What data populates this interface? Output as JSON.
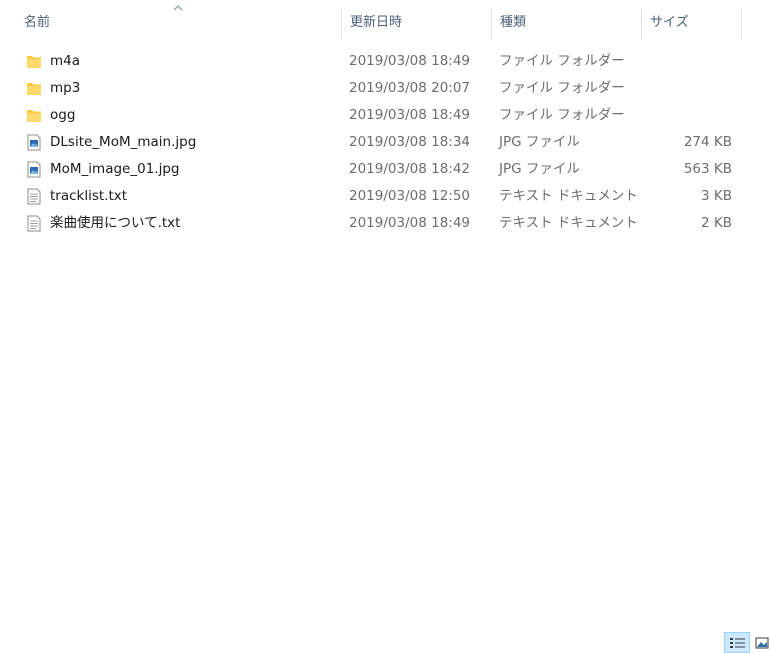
{
  "columns": {
    "name": "名前",
    "date": "更新日時",
    "type": "種類",
    "size": "サイズ"
  },
  "files": [
    {
      "name": "m4a",
      "date": "2019/03/08 18:49",
      "type": "ファイル フォルダー",
      "size": "",
      "icon": "folder-icon"
    },
    {
      "name": "mp3",
      "date": "2019/03/08 20:07",
      "type": "ファイル フォルダー",
      "size": "",
      "icon": "folder-icon"
    },
    {
      "name": "ogg",
      "date": "2019/03/08 18:49",
      "type": "ファイル フォルダー",
      "size": "",
      "icon": "folder-icon"
    },
    {
      "name": "DLsite_MoM_main.jpg",
      "date": "2019/03/08 18:34",
      "type": "JPG ファイル",
      "size": "274 KB",
      "icon": "image-file-icon"
    },
    {
      "name": "MoM_image_01.jpg",
      "date": "2019/03/08 18:42",
      "type": "JPG ファイル",
      "size": "563 KB",
      "icon": "image-file-icon"
    },
    {
      "name": "tracklist.txt",
      "date": "2019/03/08 12:50",
      "type": "テキスト ドキュメント",
      "size": "3 KB",
      "icon": "text-file-icon"
    },
    {
      "name": "楽曲使用について.txt",
      "date": "2019/03/08 18:49",
      "type": "テキスト ドキュメント",
      "size": "2 KB",
      "icon": "text-file-icon"
    }
  ],
  "colors": {
    "header_text": "#4c607a",
    "folder": "#ffc83d",
    "selected_view_bg": "#cce8ff"
  }
}
